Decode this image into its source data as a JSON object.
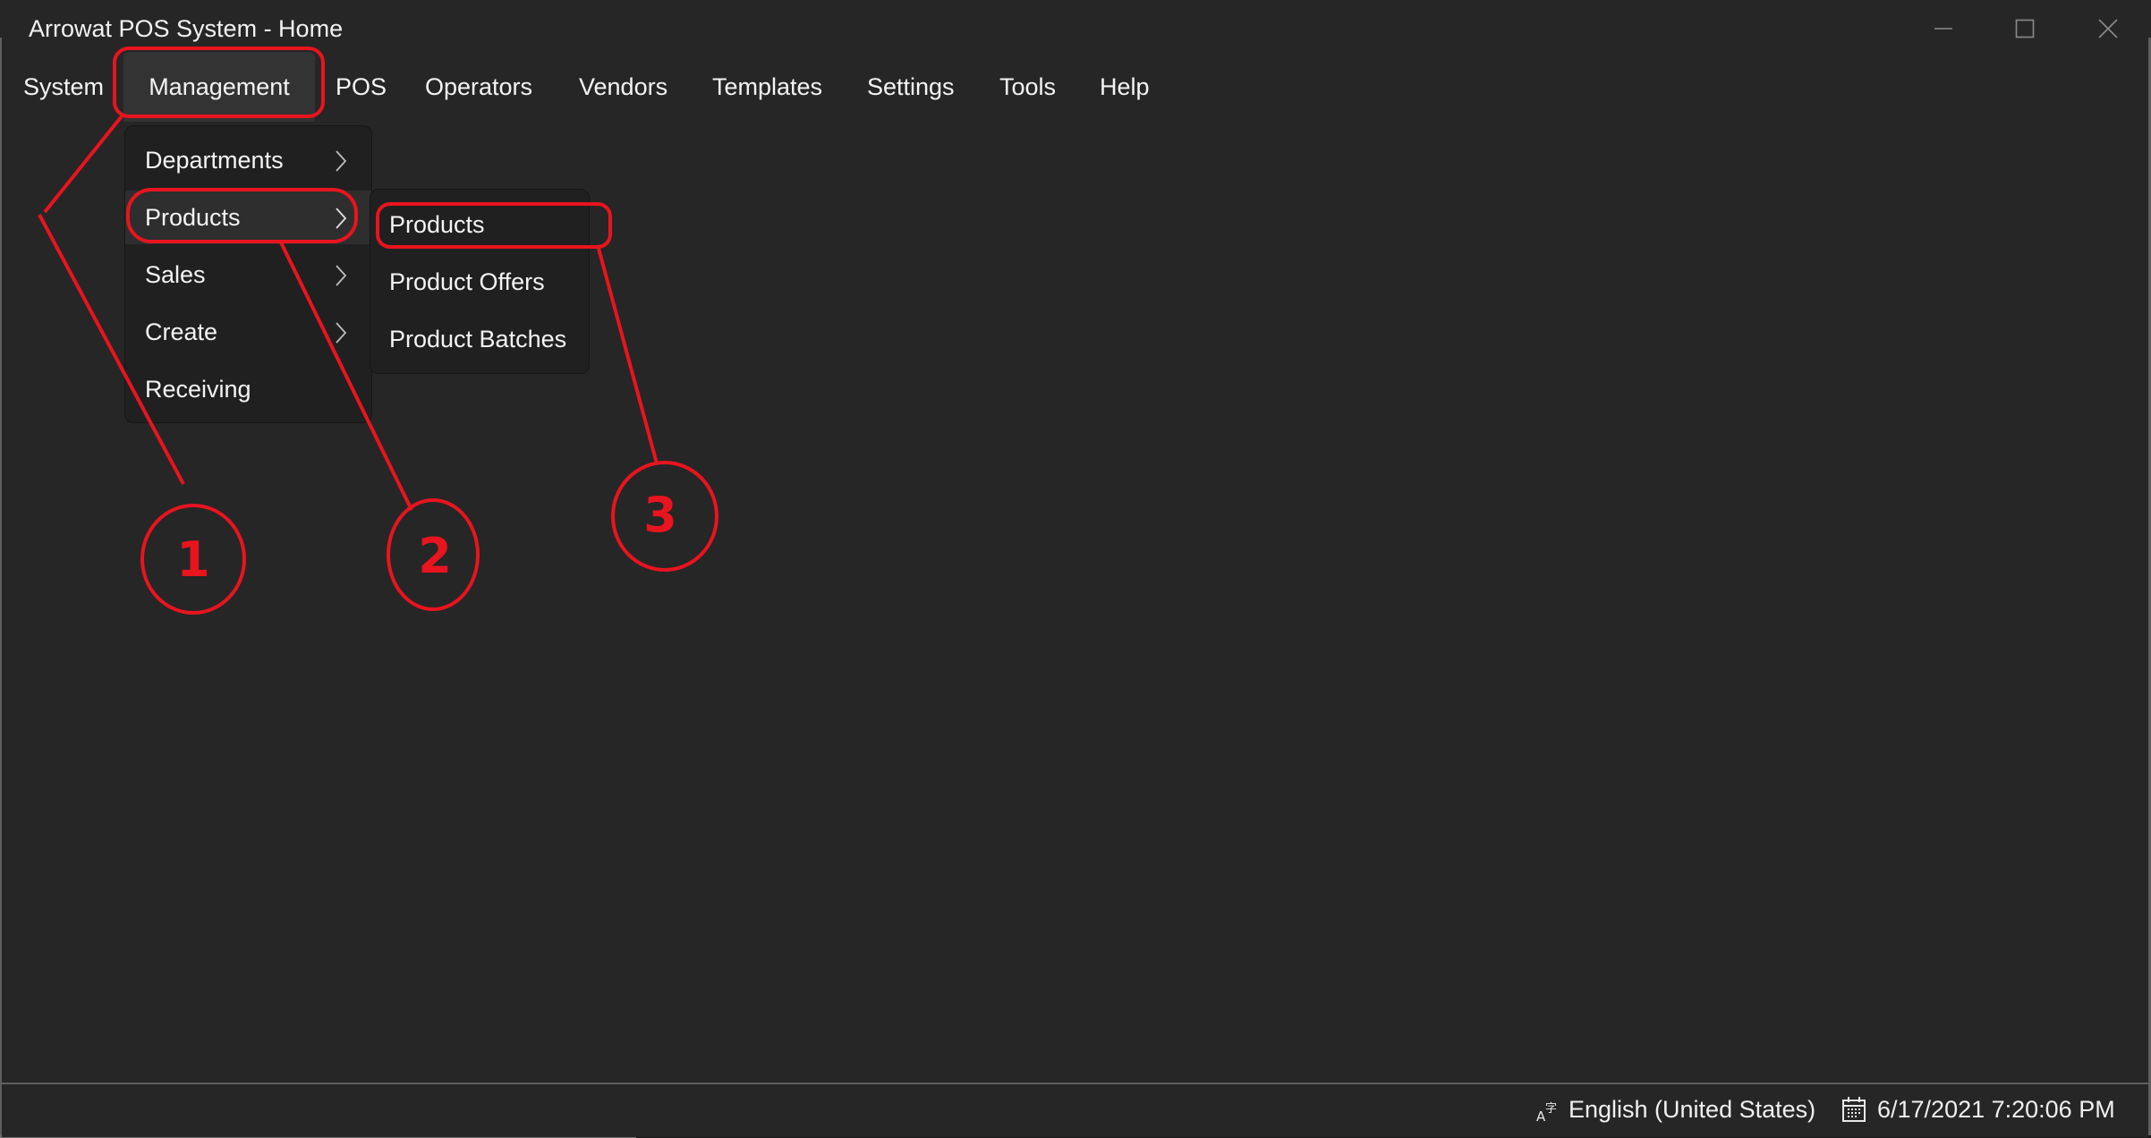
{
  "window": {
    "title": "Arrowat POS System - Home",
    "controls": [
      {
        "name": "minimize",
        "icon": "minimize-icon"
      },
      {
        "name": "maximize",
        "icon": "maximize-icon"
      },
      {
        "name": "close",
        "icon": "close-icon"
      }
    ]
  },
  "menubar": {
    "items": [
      {
        "label": "System"
      },
      {
        "label": "Management",
        "active": true
      },
      {
        "label": "POS"
      },
      {
        "label": "Operators"
      },
      {
        "label": "Vendors"
      },
      {
        "label": "Templates"
      },
      {
        "label": "Settings"
      },
      {
        "label": "Tools"
      },
      {
        "label": "Help"
      }
    ]
  },
  "management_menu": {
    "items": [
      {
        "label": "Departments",
        "has_submenu": true
      },
      {
        "label": "Products",
        "has_submenu": true,
        "hovered": true
      },
      {
        "label": "Sales",
        "has_submenu": true
      },
      {
        "label": "Create",
        "has_submenu": true
      },
      {
        "label": "Receiving",
        "has_submenu": false
      }
    ]
  },
  "products_submenu": {
    "items": [
      {
        "label": "Products",
        "highlighted": true
      },
      {
        "label": "Product Offers"
      },
      {
        "label": "Product Batches"
      }
    ]
  },
  "statusbar": {
    "language_icon": "language-icon",
    "language": "English (United States)",
    "calendar_icon": "calendar-icon",
    "datetime": "6/17/2021 7:20:06 PM"
  },
  "annotations": {
    "color": "#e8141e",
    "steps": [
      {
        "number": "1",
        "target": "Management"
      },
      {
        "number": "2",
        "target": "Products"
      },
      {
        "number": "3",
        "target": "Products (submenu)"
      }
    ]
  }
}
